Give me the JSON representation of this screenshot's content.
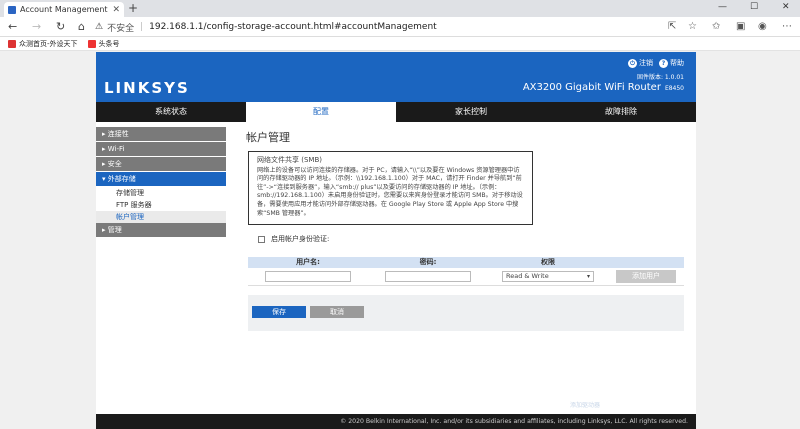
{
  "browser": {
    "tab_title": "Account Management",
    "insecure_label": "不安全",
    "url": "192.168.1.1/config-storage-account.html#accountManagement",
    "bookmarks": [
      {
        "label": "众测首页-外设天下",
        "color": "#d33"
      },
      {
        "label": "头条号",
        "color": "#e33"
      }
    ]
  },
  "header": {
    "logo": "LINKSYS",
    "logout": "注销",
    "help": "帮助",
    "firmware": "固件版本: 1.0.01",
    "model": "AX3200 Gigabit WiFi Router",
    "model_number": "E8450"
  },
  "topnav": {
    "tabs": [
      {
        "label": "系统状态",
        "active": false
      },
      {
        "label": "配置",
        "active": true
      },
      {
        "label": "家长控制",
        "active": false
      },
      {
        "label": "故障排除",
        "active": false
      }
    ]
  },
  "sidebar": {
    "items": [
      {
        "label": "▸ 连接性"
      },
      {
        "label": "▸ Wi-Fi"
      },
      {
        "label": "▸ 安全"
      },
      {
        "label": "▾ 外部存储"
      },
      {
        "label": "▸ 管理"
      }
    ],
    "subitems": [
      {
        "label": "存储管理"
      },
      {
        "label": "FTP 服务器"
      },
      {
        "label": "帐户管理"
      }
    ]
  },
  "content": {
    "title": "帐户管理",
    "smb_heading": "网络文件共享 (SMB)",
    "smb_body": "网络上的设备可以访问连接的存储器。对于 PC，请输入“\\\\”以及要在 Windows 资源管理器中访问的存储驱动器的 IP 地址。（示例：\\\\192.168.1.100）对于 MAC，请打开 Finder 并导航到“前往”->“连接到服务器”，输入“smb:// plus”以及要访问的存储驱动器的 IP 地址。（示例：smb://192.168.1.100）未启用身份验证时，您需要以来宾身份登录才能访问 SMB。对于移动设备，需要使用应用才能访问外部存储驱动器。在 Google Play Store 或 Apple App Store 中搜索“SMB 管理器”。",
    "auth_label": "启用帐户身份验证:",
    "table": {
      "col_user": "用户名:",
      "col_password": "密码:",
      "col_permission": "权限",
      "permission_value": "Read & Write",
      "add_user": "添加用户"
    },
    "save": "保存",
    "cancel": "取消",
    "ghost": "添加驱动器"
  },
  "footer": {
    "copyright": "© 2020 Belkin International, Inc. and/or its subsidiaries and affiliates, including Linksys, LLC. All rights reserved."
  }
}
